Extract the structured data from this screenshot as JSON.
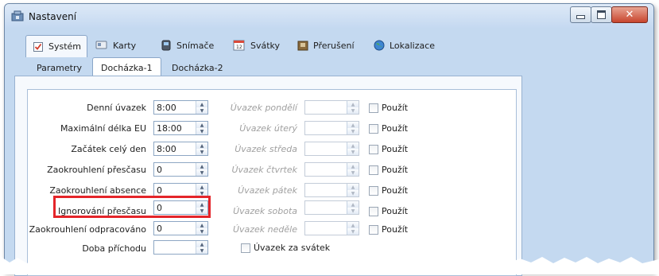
{
  "window": {
    "title": "Nastavení"
  },
  "main_tabs": [
    {
      "label": "Systém",
      "icon": "checklist-icon"
    },
    {
      "label": "Karty",
      "icon": "cards-icon"
    },
    {
      "label": "Snímače",
      "icon": "reader-icon"
    },
    {
      "label": "Svátky",
      "icon": "calendar-icon"
    },
    {
      "label": "Přerušení",
      "icon": "break-icon"
    },
    {
      "label": "Lokalizace",
      "icon": "globe-icon"
    }
  ],
  "sub_tabs": [
    {
      "label": "Parametry"
    },
    {
      "label": "Docházka-1"
    },
    {
      "label": "Docházka-2"
    }
  ],
  "left_fields": [
    {
      "label": "Denní úvazek",
      "value": "8:00"
    },
    {
      "label": "Maximální délka EU",
      "value": "18:00"
    },
    {
      "label": "Začátek celý den",
      "value": "8:00"
    },
    {
      "label": "Zaokrouhlení přesčasu",
      "value": "0"
    },
    {
      "label": "Zaokrouhlení absence",
      "value": "0"
    },
    {
      "label": "Ignorování přesčasu",
      "value": "0"
    },
    {
      "label": "Zaokrouhlení odpracováno",
      "value": "0"
    },
    {
      "label": "Doba příchodu",
      "value": ""
    }
  ],
  "right_fields": [
    {
      "label": "Úvazek pondělí",
      "value": "",
      "checkbox": "Použít"
    },
    {
      "label": "Úvazek úterý",
      "value": "",
      "checkbox": "Použít"
    },
    {
      "label": "Úvazek středa",
      "value": "",
      "checkbox": "Použít"
    },
    {
      "label": "Úvazek čtvrtek",
      "value": "",
      "checkbox": "Použít"
    },
    {
      "label": "Úvazek pátek",
      "value": "",
      "checkbox": "Použít"
    },
    {
      "label": "Úvazek sobota",
      "value": "",
      "checkbox": "Použít"
    },
    {
      "label": "Úvazek neděle",
      "value": "",
      "checkbox": "Použít"
    }
  ],
  "holiday_checkbox": "Úvazek za svátek",
  "colors": {
    "highlight": "#e4252a",
    "window_bg": "#c4d9f0"
  }
}
